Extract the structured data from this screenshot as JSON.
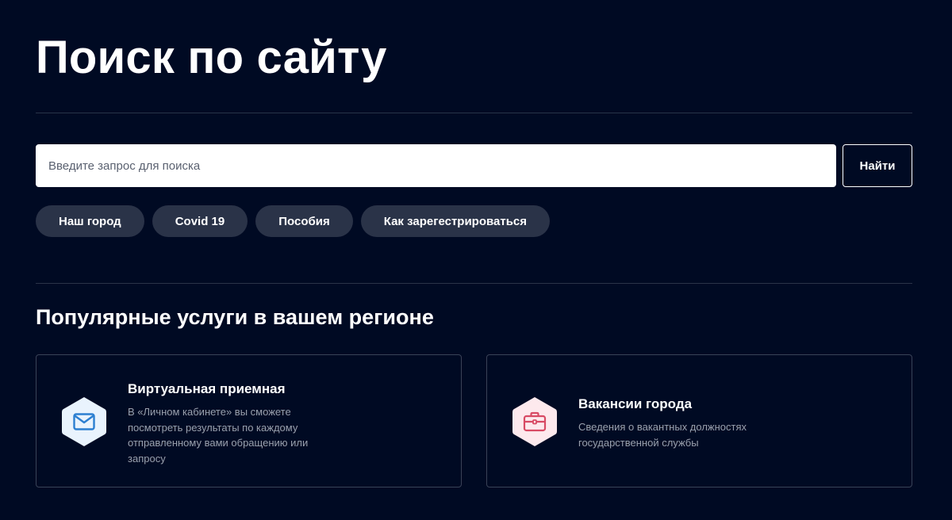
{
  "page": {
    "title": "Поиск по сайту"
  },
  "search": {
    "placeholder": "Введите запрос для поиска",
    "value": "",
    "button_label": "Найти"
  },
  "tags": [
    {
      "label": "Наш город"
    },
    {
      "label": "Covid 19"
    },
    {
      "label": "Пособия"
    },
    {
      "label": "Как зарегестрироваться"
    }
  ],
  "services": {
    "title": "Популярные услуги в вашем регионе",
    "cards": [
      {
        "title": "Виртуальная приемная",
        "description": "В «Личном кабинете» вы сможете посмотреть результаты по каждому отправленному вами обращению или запросу",
        "icon": "mail-icon",
        "icon_bg": "#e9f3fd",
        "icon_color": "#2c7fd1"
      },
      {
        "title": "Вакансии города",
        "description": "Сведения о вакантных должностях государственной службы",
        "icon": "briefcase-icon",
        "icon_bg": "#fde9ed",
        "icon_color": "#d84a64"
      }
    ]
  },
  "colors": {
    "background": "#000a23",
    "tag_bg": "#2a3348",
    "divider": "#2a3348",
    "card_border": "#3a4257",
    "muted_text": "#9aa0ad"
  }
}
